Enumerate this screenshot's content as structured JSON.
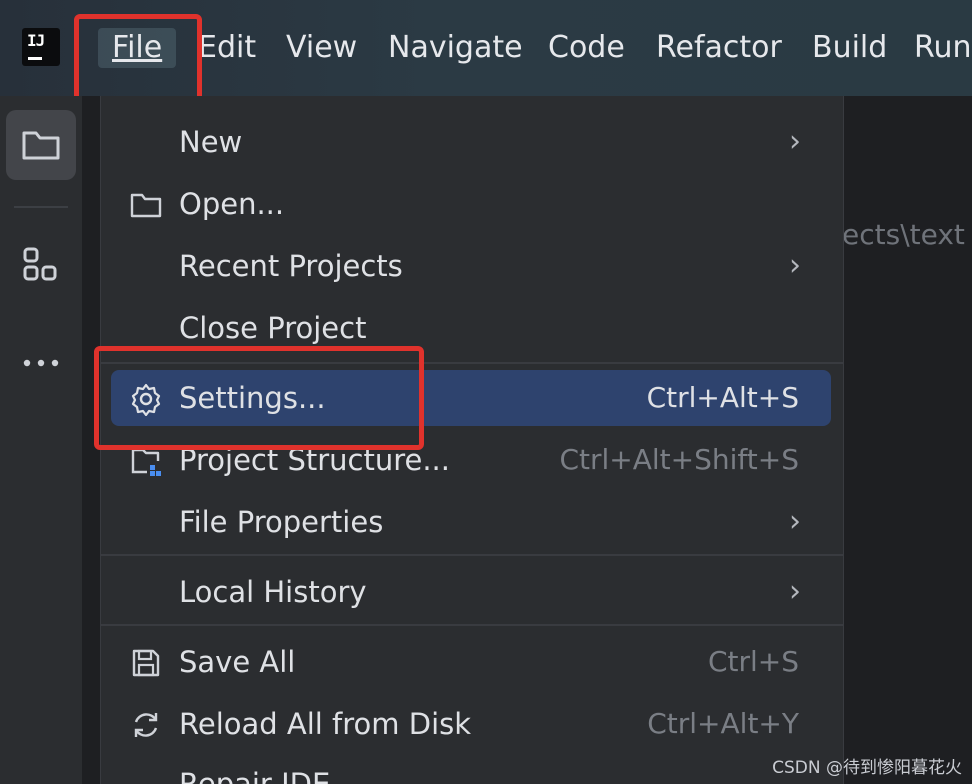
{
  "menubar": {
    "logo_text": "IJ",
    "items": [
      "File",
      "Edit",
      "View",
      "Navigate",
      "Code",
      "Refactor",
      "Build",
      "Run"
    ]
  },
  "background": {
    "path_fragment": "ects\\text"
  },
  "toolstrip": {
    "icons": [
      "folder-icon",
      "structure-icon",
      "more-icon"
    ]
  },
  "file_menu": {
    "items": [
      {
        "label": "New",
        "submenu": true
      },
      {
        "label": "Open...",
        "icon": "folder-icon"
      },
      {
        "label": "Recent Projects",
        "submenu": true
      },
      {
        "label": "Close Project"
      },
      {
        "label": "Settings...",
        "icon": "gear-icon",
        "shortcut": "Ctrl+Alt+S",
        "highlighted": true
      },
      {
        "label": "Project Structure...",
        "icon": "project-structure-icon",
        "shortcut": "Ctrl+Alt+Shift+S"
      },
      {
        "label": "File Properties",
        "submenu": true
      },
      {
        "label": "Local History",
        "submenu": true
      },
      {
        "label": "Save All",
        "icon": "save-icon",
        "shortcut": "Ctrl+S"
      },
      {
        "label": "Reload All from Disk",
        "icon": "reload-icon",
        "shortcut": "Ctrl+Alt+Y"
      },
      {
        "label": "Repair IDE"
      }
    ],
    "submenu_arrow": "›"
  },
  "watermark": "CSDN @待到惨阳暮花火",
  "colors": {
    "highlight": "#2e436e",
    "annotation_red": "#e0322c",
    "menu_bg": "#2b2d30"
  }
}
